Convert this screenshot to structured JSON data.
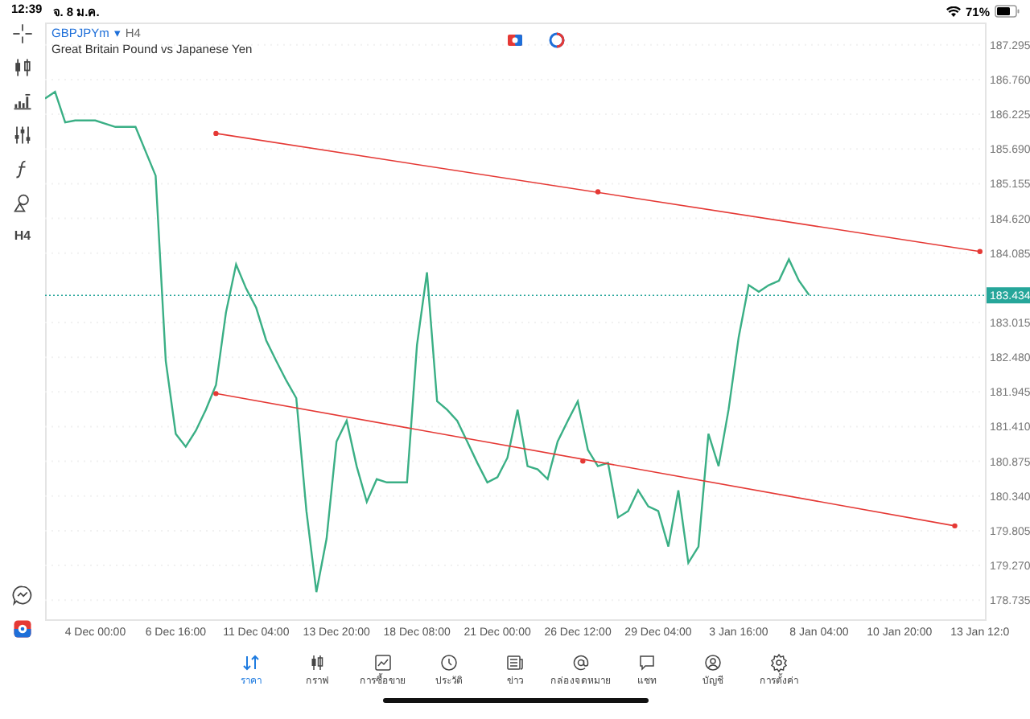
{
  "status_bar": {
    "time": "12:39",
    "date": "จ. 8 ม.ค.",
    "battery": "71%"
  },
  "toolbar": [
    {
      "kind": "crosshair"
    },
    {
      "kind": "candles"
    },
    {
      "kind": "bars"
    },
    {
      "kind": "sliders"
    },
    {
      "kind": "function"
    },
    {
      "kind": "shapes"
    },
    {
      "kind": "text",
      "label": "H4"
    }
  ],
  "toolbar_bottom": [
    {
      "kind": "chat"
    },
    {
      "kind": "logo"
    }
  ],
  "chart": {
    "symbol": "GBPJPYm",
    "symbol_caret": "▾",
    "timeframe": "H4",
    "description": "Great Britain Pound vs Japanese Yen",
    "buttons": [
      {
        "kind": "trade"
      },
      {
        "kind": "signal"
      }
    ],
    "chart_data": {
      "type": "line",
      "categories": [
        null,
        null,
        null,
        null,
        null,
        "4 Dec 00:00",
        null,
        null,
        null,
        null,
        null,
        null,
        null,
        "6 Dec 16:00",
        null,
        null,
        null,
        null,
        null,
        null,
        null,
        "11 Dec 04:00",
        null,
        null,
        null,
        null,
        null,
        null,
        null,
        "13 Dec 20:00",
        null,
        null,
        null,
        null,
        null,
        null,
        null,
        "18 Dec 08:00",
        null,
        null,
        null,
        null,
        null,
        null,
        null,
        "21 Dec 00:00",
        null,
        null,
        null,
        null,
        null,
        null,
        null,
        "26 Dec 12:00",
        null,
        null,
        null,
        null,
        null,
        null,
        null,
        "29 Dec 04:00",
        null,
        null,
        null,
        null,
        null,
        null,
        null,
        "3 Jan 16:00",
        null,
        null,
        null,
        null,
        null,
        null,
        null,
        "8 Jan 04:00",
        null,
        null,
        null,
        null,
        null,
        null,
        null,
        "10 Jan 20:00",
        null,
        null,
        null,
        null,
        null,
        null,
        null,
        "13 Jan 12:0"
      ],
      "series": [
        {
          "color": "#3aaf85",
          "values": [
            186.47,
            186.57,
            186.1,
            186.13,
            186.13,
            186.13,
            186.08,
            186.03,
            186.03,
            186.03,
            185.65,
            185.28,
            182.42,
            181.3,
            181.1,
            181.35,
            181.67,
            182.05,
            183.17,
            183.91,
            183.54,
            183.24,
            182.74,
            182.42,
            182.12,
            181.85,
            180.11,
            178.86,
            179.68,
            181.18,
            181.5,
            180.8,
            180.25,
            180.6,
            180.55,
            180.55,
            180.55,
            182.67,
            183.79,
            181.8,
            181.67,
            181.5,
            181.18,
            180.85,
            180.55,
            180.63,
            180.93,
            181.67,
            180.8,
            180.75,
            180.6,
            181.18,
            181.5,
            181.8,
            181.05,
            180.8,
            180.85,
            180.01,
            180.11,
            180.43,
            180.18,
            180.11,
            179.56,
            180.43,
            179.31,
            179.56,
            181.3,
            180.8,
            181.67,
            182.79,
            183.59,
            183.49,
            183.59,
            183.66,
            183.99,
            183.66,
            183.44,
            null,
            null,
            null,
            null,
            null,
            null,
            null,
            null,
            null,
            null,
            null,
            null,
            null,
            null,
            null,
            null,
            null
          ]
        }
      ],
      "ylim": [
        178.44,
        187.64
      ],
      "yticks": [
        {
          "value": 187.295,
          "label": "187.295"
        },
        {
          "value": 186.76,
          "label": "186.760"
        },
        {
          "value": 186.225,
          "label": "186.225"
        },
        {
          "value": 185.69,
          "label": "185.690"
        },
        {
          "value": 185.155,
          "label": "185.155"
        },
        {
          "value": 184.62,
          "label": "184.620"
        },
        {
          "value": 184.085,
          "label": "184.085"
        },
        {
          "value": 183.015,
          "label": "183.015"
        },
        {
          "value": 182.48,
          "label": "182.480"
        },
        {
          "value": 181.945,
          "label": "181.945"
        },
        {
          "value": 181.41,
          "label": "181.410"
        },
        {
          "value": 180.875,
          "label": "180.875"
        },
        {
          "value": 180.34,
          "label": "180.340"
        },
        {
          "value": 179.805,
          "label": "179.805"
        },
        {
          "value": 179.27,
          "label": "179.270"
        },
        {
          "value": 178.735,
          "label": "178.735"
        }
      ],
      "grid": true,
      "ref_lines": [
        {
          "axis": "y",
          "value": 183.434,
          "label": "183.434"
        }
      ]
    }
  },
  "tabs": [
    {
      "kind": "quotes",
      "label": "ราคา",
      "selected": true
    },
    {
      "kind": "chart",
      "label": "กราฟ",
      "selected": false
    },
    {
      "kind": "trade",
      "label": "การซื้อขาย",
      "selected": false
    },
    {
      "kind": "history",
      "label": "ประวัติ",
      "selected": false
    },
    {
      "kind": "news",
      "label": "ข่าว",
      "selected": false
    },
    {
      "kind": "mail",
      "label": "กล่องจดหมาย",
      "selected": false
    },
    {
      "kind": "chat",
      "label": "แชท",
      "selected": false
    },
    {
      "kind": "account",
      "label": "บัญชี",
      "selected": false
    },
    {
      "kind": "settings",
      "label": "การตั้งค่า",
      "selected": false
    }
  ]
}
